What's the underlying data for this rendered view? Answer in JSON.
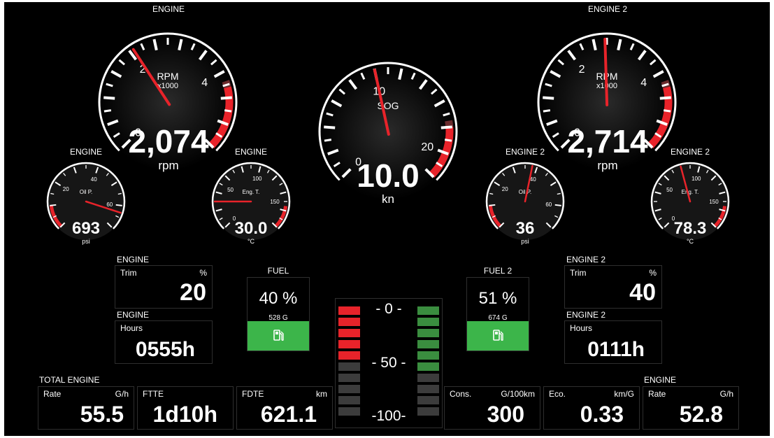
{
  "colors": {
    "background": "#000000",
    "redline": "#e8232a",
    "needle": "#e8232a",
    "fuel_fill": "#3cb54a",
    "tank_red": "#e8232a",
    "tank_green": "#3a8d3f",
    "tank_empty": "#3c3c3c"
  },
  "engine1": {
    "header": "ENGINE",
    "rpm_gauge": {
      "label": "RPM",
      "multiplier": "x1000",
      "ticks": [
        "0",
        "2",
        "4"
      ],
      "value": "2,074",
      "unit": "rpm",
      "needle_value": 2.074,
      "max": 5.5,
      "redline_from": 4.3
    },
    "oil": {
      "header": "ENGINE",
      "label": "Oil P.",
      "ticks": [
        "20",
        "40",
        "60"
      ],
      "value": "693",
      "unit": "psi",
      "needle_value": 63,
      "min": 0,
      "max": 70
    },
    "temp": {
      "header": "ENGINE",
      "label": "Eng. T.",
      "ticks": [
        "0",
        "50",
        "100",
        "150"
      ],
      "value": "30.0",
      "unit": "°C",
      "needle_value": 30,
      "min": 0,
      "max": 180
    },
    "trim": {
      "header": "ENGINE",
      "label": "Trim",
      "unit": "%",
      "value": "20"
    },
    "hours": {
      "header": "ENGINE",
      "label": "Hours",
      "value": "0555h"
    }
  },
  "engine2": {
    "header": "ENGINE 2",
    "rpm_gauge": {
      "label": "RPM",
      "multiplier": "x1000",
      "ticks": [
        "0",
        "2",
        "4"
      ],
      "value": "2,714",
      "unit": "rpm",
      "needle_value": 2.714,
      "max": 5.5,
      "redline_from": 4.3
    },
    "oil": {
      "header": "ENGINE 2",
      "label": "Oil P.",
      "ticks": [
        "20",
        "40",
        "60"
      ],
      "value": "36",
      "unit": "psi",
      "needle_value": 38,
      "min": 0,
      "max": 70
    },
    "temp": {
      "header": "ENGINE 2",
      "label": "Eng. T.",
      "ticks": [
        "0",
        "50",
        "100",
        "150"
      ],
      "value": "78.3",
      "unit": "°C",
      "needle_value": 80,
      "min": 0,
      "max": 180
    },
    "trim": {
      "header": "ENGINE 2",
      "label": "Trim",
      "unit": "%",
      "value": "40"
    },
    "hours": {
      "header": "ENGINE 2",
      "label": "Hours",
      "value": "0111h"
    }
  },
  "sog": {
    "label": "SOG",
    "ticks": [
      "0",
      "10",
      "20"
    ],
    "value": "10.0",
    "unit": "kn",
    "needle_value": 10,
    "min": 0,
    "max": 22,
    "redline_from": 18
  },
  "fuel1": {
    "header": "FUEL",
    "percent": "40 %",
    "gallons": "528 G",
    "level": 0.4
  },
  "fuel2": {
    "header": "FUEL 2",
    "percent": "51 %",
    "gallons": "674 G",
    "level": 0.51
  },
  "tank": {
    "marks": [
      "- 0 -",
      "- 50 -",
      "-100-"
    ],
    "left_red_count": 5,
    "right_green_count": 6,
    "segments_per_side": 10
  },
  "bottom": {
    "left_header": "TOTAL ENGINE",
    "right_header": "ENGINE",
    "cells": [
      {
        "label": "Rate",
        "unit": "G/h",
        "value": "55.5"
      },
      {
        "label": "FTTE",
        "unit": "",
        "value": "1d10h"
      },
      {
        "label": "FDTE",
        "unit": "km",
        "value": "621.1"
      },
      {
        "label": "Cons.",
        "unit": "G/100km",
        "value": "300"
      },
      {
        "label": "Eco.",
        "unit": "km/G",
        "value": "0.33"
      },
      {
        "label": "Rate",
        "unit": "G/h",
        "value": "52.8"
      }
    ]
  }
}
